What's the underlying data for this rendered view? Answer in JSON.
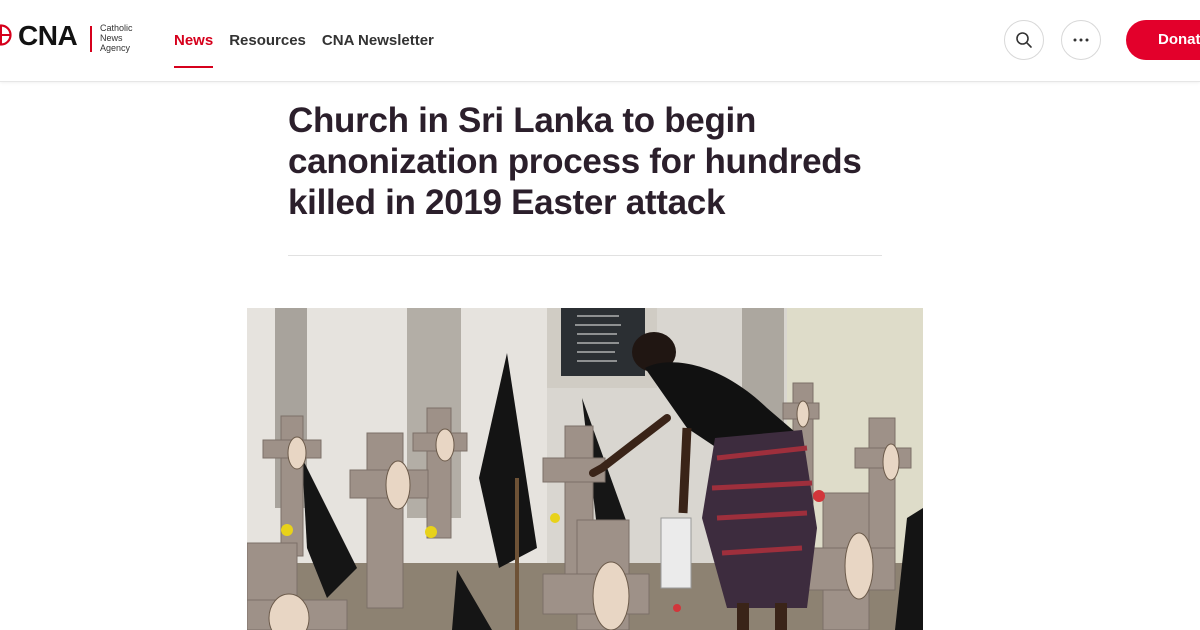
{
  "site": {
    "logo_text": "CNA",
    "logo_subtitle": "Catholic News Agency"
  },
  "nav": {
    "items": [
      {
        "label": "News",
        "active": true
      },
      {
        "label": "Resources",
        "active": false
      },
      {
        "label": "CNA Newsletter",
        "active": false
      }
    ]
  },
  "header_actions": {
    "search_icon": "search-icon",
    "more_icon": "more-horizontal-icon",
    "donate_label": "Donate"
  },
  "article": {
    "headline": "Church in Sri Lanka to begin canonization process for hundreds killed in 2019 Easter attack"
  },
  "colors": {
    "brand_red": "#d6001c",
    "donate_red": "#e3002b",
    "headline": "#2b1f2b"
  }
}
